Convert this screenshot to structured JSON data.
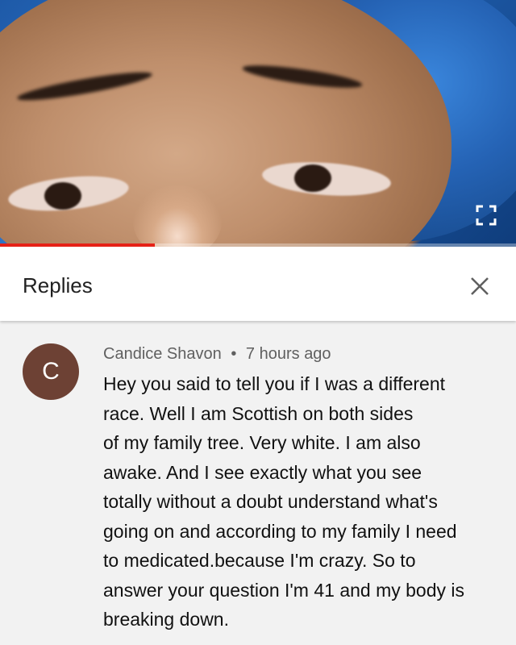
{
  "video": {
    "progress_fraction": 0.3,
    "accent_color": "#e62117",
    "fullscreen_icon": "fullscreen-icon"
  },
  "replies_panel": {
    "title": "Replies",
    "close_icon": "close-icon"
  },
  "comment": {
    "avatar_letter": "C",
    "avatar_color": "#6d4134",
    "author": "Candice Shavon",
    "separator": "•",
    "timestamp": "7 hours ago",
    "text_lines": [
      "Hey you said to tell you if I was a different",
      "race. Well I am Scottish on both sides",
      "of my family tree. Very white. I am also",
      "awake. And I see exactly what you see",
      "totally without a doubt understand what's",
      "going on and according to my family I need",
      "to medicated.because I'm crazy.  So to",
      "answer your question I'm 41 and my body is",
      "breaking down."
    ]
  }
}
